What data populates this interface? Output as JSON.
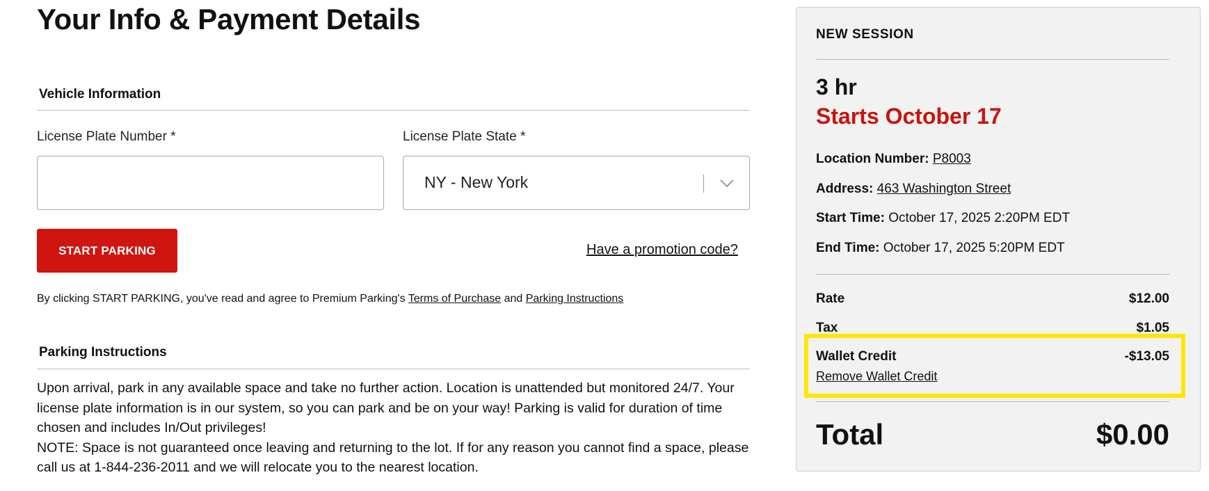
{
  "page": {
    "title": "Your Info & Payment Details"
  },
  "vehicle": {
    "heading": "Vehicle Information",
    "plate_label": "License Plate Number *",
    "plate_value": "",
    "state_label": "License Plate State *",
    "state_value": "NY - New York"
  },
  "actions": {
    "start_label": "START PARKING",
    "promo_label": "Have a promotion code?"
  },
  "agreement": {
    "prefix": "By clicking START PARKING, you've read and agree to Premium Parking's ",
    "terms_link": "Terms of Purchase",
    "middle": " and ",
    "instructions_link": "Parking Instructions"
  },
  "instructions": {
    "heading": "Parking Instructions",
    "paragraph1": "Upon arrival, park in any available space and take no further action. Location is unattended but monitored 24/7. Your license plate information is in our system, so you can park and be on your way! Parking is valid for duration of time chosen and includes In/Out privileges!",
    "paragraph2": "NOTE: Space is not guaranteed once leaving and returning to the lot. If for any reason you cannot find a space, please call us at 1-844-236-2011 and we will relocate you to the nearest location."
  },
  "summary": {
    "title": "NEW SESSION",
    "duration": "3 hr",
    "starts": "Starts October 17",
    "location_label": "Location Number:",
    "location_value": "P8003",
    "address_label": "Address:",
    "address_value": "463 Washington Street",
    "start_label": "Start Time:",
    "start_value": "October 17, 2025 2:20PM EDT",
    "end_label": "End Time:",
    "end_value": "October 17, 2025 5:20PM EDT",
    "rate_label": "Rate",
    "rate_value": "$12.00",
    "tax_label": "Tax",
    "tax_value": "$1.05",
    "wallet_label": "Wallet Credit",
    "wallet_value": "-$13.05",
    "remove_wallet": "Remove Wallet Credit",
    "total_label": "Total",
    "total_value": "$0.00"
  },
  "colors": {
    "accent_red": "#d0140f",
    "highlight_yellow": "#ffe600",
    "panel_bg": "#f2f2f2"
  },
  "icons": {
    "select_arrow": "chevron-down-icon"
  }
}
